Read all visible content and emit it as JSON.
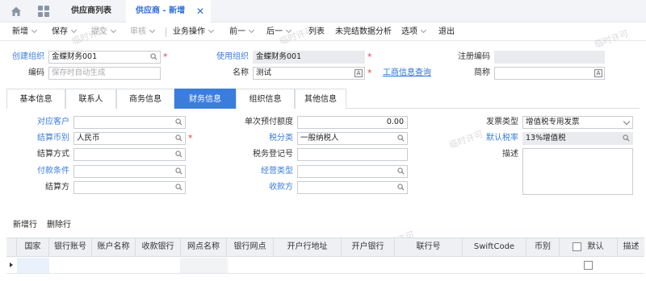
{
  "tabs": {
    "list_tab": "供应商列表",
    "active_tab": "供应商 - 新增",
    "close": "✕"
  },
  "toolbar": {
    "new": "新增",
    "save": "保存",
    "submit": "提交",
    "audit": "审核",
    "business_ops": "业务操作",
    "prev": "前一",
    "next": "后一",
    "columns": "列表",
    "incomplete_analysis": "未完结数据分析",
    "options": "选项",
    "exit": "退出"
  },
  "watermark": "临时许可",
  "form": {
    "create_org": {
      "label": "创建组织",
      "value": "金蝶财务001"
    },
    "use_org": {
      "label": "使用组织",
      "value": "金蝶财务001"
    },
    "reg_code": {
      "label": "注册编码",
      "value": ""
    },
    "code": {
      "label": "编码",
      "placeholder": "保存时自动生成"
    },
    "name": {
      "label": "名称",
      "value": "测试"
    },
    "biz_info_link": "工商信息查询",
    "short_name": {
      "label": "简称",
      "value": ""
    }
  },
  "section_tabs": [
    "基本信息",
    "联系人",
    "商务信息",
    "财务信息",
    "组织信息",
    "其他信息"
  ],
  "finance": {
    "customer": {
      "label": "对应客户",
      "value": ""
    },
    "settle_currency": {
      "label": "结算币别",
      "value": "人民币"
    },
    "settle_method": {
      "label": "结算方式",
      "value": ""
    },
    "pay_terms": {
      "label": "付款条件",
      "value": ""
    },
    "settle_party": {
      "label": "结算方",
      "value": ""
    },
    "single_prepay": {
      "label": "单次预付额度",
      "value": "0.00"
    },
    "tax_type": {
      "label": "税分类",
      "value": "一般纳税人"
    },
    "tax_reg_no": {
      "label": "税务登记号",
      "value": ""
    },
    "biz_type": {
      "label": "经营类型",
      "value": ""
    },
    "payee": {
      "label": "收款方",
      "value": ""
    },
    "invoice_type": {
      "label": "发票类型",
      "value": "增值税专用发票"
    },
    "default_tax_rate": {
      "label": "默认税率",
      "value": "13%增值税"
    },
    "description": {
      "label": "描述",
      "value": ""
    }
  },
  "bank_grid": {
    "add_row": "新增行",
    "delete_row": "删除行",
    "columns": [
      "国家",
      "银行账号",
      "账户名称",
      "收款银行",
      "网点名称",
      "银行网点",
      "开户行地址",
      "开户银行",
      "联行号",
      "SwiftCode",
      "币别",
      "默认",
      "描述"
    ]
  }
}
